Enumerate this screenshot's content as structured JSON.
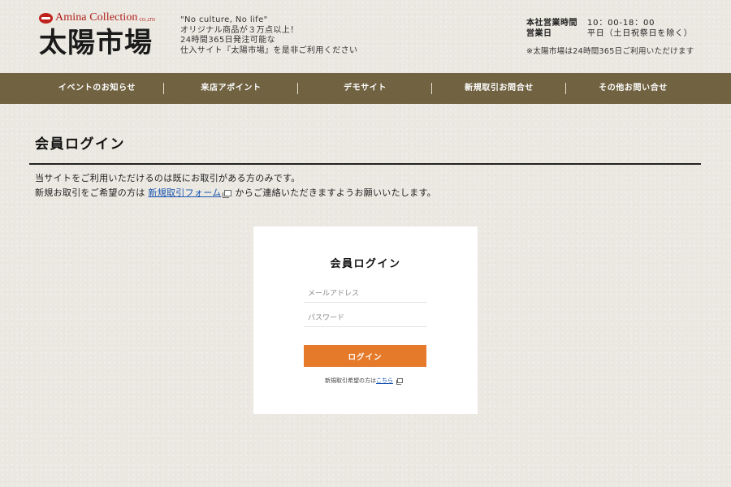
{
  "header": {
    "brand": "Amina Collection",
    "brand_suffix": "CO.,LTD",
    "site_name": "太陽市場",
    "tagline": [
      "\"No culture, No life\"",
      "オリジナル商品が３万点以上！",
      "24時間365日発注可能な",
      "仕入サイト『太陽市場』を是非ご利用ください"
    ],
    "hours_label": "本社営業時間",
    "hours_value": "10：00-18：00",
    "days_label": "営業日",
    "days_value": "平日（土日祝祭日を除く）",
    "note": "※太陽市場は24時間365日ご利用いただけます"
  },
  "nav": {
    "items": [
      {
        "label": "イベントのお知らせ"
      },
      {
        "label": "来店アポイント"
      },
      {
        "label": "デモサイト"
      },
      {
        "label": "新規取引お問合せ"
      },
      {
        "label": "その他お問い合せ"
      }
    ]
  },
  "main": {
    "title": "会員ログイン",
    "intro_line1": "当サイトをご利用いただけるのは既にお取引がある方のみです。",
    "intro_line2_prefix": "新規お取引をご希望の方は",
    "intro_link": "新規取引フォーム",
    "intro_line2_suffix": "からご連絡いただきますようお願いいたします。"
  },
  "login": {
    "title": "会員ログイン",
    "email_placeholder": "メールアドレス",
    "password_placeholder": "パスワード",
    "submit_label": "ログイン",
    "note_prefix": "新規取引希望の方は",
    "note_link": "こちら"
  },
  "colors": {
    "nav_bg": "#716342",
    "button_bg": "#e57a2a",
    "brand_red": "#b01e1a",
    "link": "#1a55b0"
  },
  "icons": {
    "external_link": "external-link-icon",
    "logo_mark": "logo-mark-icon"
  }
}
